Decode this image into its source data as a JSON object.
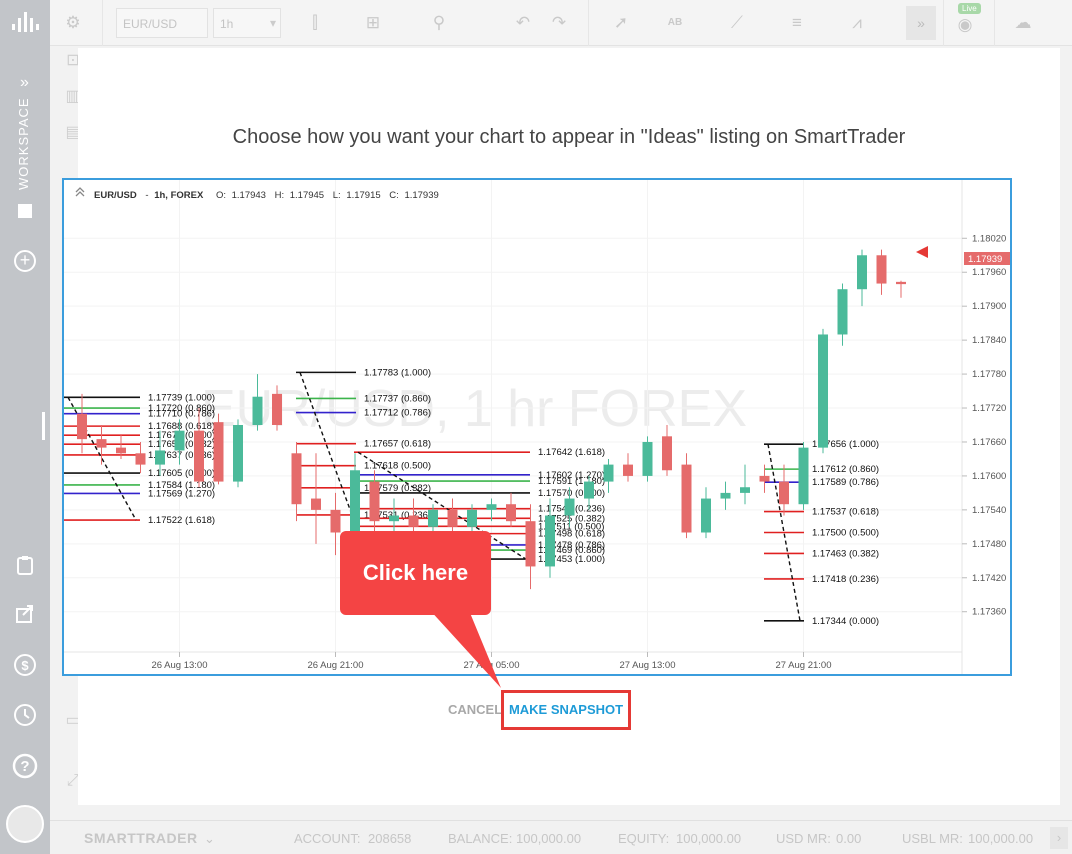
{
  "sidebar": {
    "workspace_label": "WORKSPACE"
  },
  "toolbar": {
    "symbol": "EUR/USD",
    "timeframe": "1h",
    "live_badge": "Live"
  },
  "modal": {
    "title": "Choose how you want your chart to appear in \"Ideas\" listing on SmartTrader",
    "cancel_label": "CANCEL",
    "snapshot_label": "MAKE SNAPSHOT",
    "callout_label": "Click here"
  },
  "chart": {
    "header": {
      "symbol": "EUR/USD",
      "interval": "1h, FOREX",
      "open_label": "O:",
      "open": "1.17943",
      "high_label": "H:",
      "high": "1.17945",
      "low_label": "L:",
      "low": "1.17915",
      "close_label": "C:",
      "close": "1.17939"
    },
    "watermark": "EUR/USD, 1 hr FOREX",
    "current_price": "1.17939",
    "colors": {
      "up": "#4bba9a",
      "down": "#e56b6b",
      "fib_black": "#111111",
      "fib_green": "#3cb44b",
      "fib_blue": "#3322cc",
      "fib_red": "#e02020",
      "accent": "#3b9ddd"
    }
  },
  "chart_data": {
    "type": "candlestick",
    "y_ticks": [
      "1.18020",
      "1.17960",
      "1.17900",
      "1.17840",
      "1.17780",
      "1.17720",
      "1.17660",
      "1.17600",
      "1.17540",
      "1.17480",
      "1.17420",
      "1.17360"
    ],
    "ylim": [
      1.1731,
      1.1807
    ],
    "x_ticks": [
      "26 Aug 13:00",
      "26 Aug 21:00",
      "27 Aug 05:00",
      "27 Aug 13:00",
      "27 Aug 21:00"
    ],
    "candles": [
      {
        "i": 0,
        "o": 1.1771,
        "h": 1.17745,
        "l": 1.1764,
        "c": 1.17665
      },
      {
        "i": 1,
        "o": 1.17665,
        "h": 1.1769,
        "l": 1.1762,
        "c": 1.1765
      },
      {
        "i": 2,
        "o": 1.1765,
        "h": 1.17672,
        "l": 1.1763,
        "c": 1.1764
      },
      {
        "i": 3,
        "o": 1.1764,
        "h": 1.1766,
        "l": 1.17605,
        "c": 1.1762
      },
      {
        "i": 4,
        "o": 1.1762,
        "h": 1.1768,
        "l": 1.176,
        "c": 1.17645
      },
      {
        "i": 5,
        "o": 1.17645,
        "h": 1.177,
        "l": 1.1762,
        "c": 1.1768
      },
      {
        "i": 6,
        "o": 1.1768,
        "h": 1.1772,
        "l": 1.1758,
        "c": 1.1759
      },
      {
        "i": 7,
        "o": 1.17695,
        "h": 1.1771,
        "l": 1.17585,
        "c": 1.1759
      },
      {
        "i": 8,
        "o": 1.1759,
        "h": 1.177,
        "l": 1.1758,
        "c": 1.1769
      },
      {
        "i": 9,
        "o": 1.1769,
        "h": 1.1778,
        "l": 1.1768,
        "c": 1.1774
      },
      {
        "i": 10,
        "o": 1.17745,
        "h": 1.1776,
        "l": 1.1768,
        "c": 1.1769
      },
      {
        "i": 11,
        "o": 1.1764,
        "h": 1.1766,
        "l": 1.1752,
        "c": 1.1755
      },
      {
        "i": 12,
        "o": 1.1756,
        "h": 1.1764,
        "l": 1.1748,
        "c": 1.1754
      },
      {
        "i": 13,
        "o": 1.1754,
        "h": 1.1757,
        "l": 1.1746,
        "c": 1.175
      },
      {
        "i": 14,
        "o": 1.175,
        "h": 1.1764,
        "l": 1.1749,
        "c": 1.1761
      },
      {
        "i": 15,
        "o": 1.1759,
        "h": 1.1761,
        "l": 1.1748,
        "c": 1.1752
      },
      {
        "i": 16,
        "o": 1.1752,
        "h": 1.1756,
        "l": 1.175,
        "c": 1.1753
      },
      {
        "i": 17,
        "o": 1.1753,
        "h": 1.1756,
        "l": 1.175,
        "c": 1.1751
      },
      {
        "i": 18,
        "o": 1.1751,
        "h": 1.1755,
        "l": 1.1749,
        "c": 1.1754
      },
      {
        "i": 19,
        "o": 1.1754,
        "h": 1.1756,
        "l": 1.175,
        "c": 1.1751
      },
      {
        "i": 20,
        "o": 1.1751,
        "h": 1.1755,
        "l": 1.17495,
        "c": 1.1754
      },
      {
        "i": 21,
        "o": 1.1754,
        "h": 1.1756,
        "l": 1.1752,
        "c": 1.1755
      },
      {
        "i": 22,
        "o": 1.1755,
        "h": 1.1757,
        "l": 1.1751,
        "c": 1.1752
      },
      {
        "i": 23,
        "o": 1.1752,
        "h": 1.1755,
        "l": 1.174,
        "c": 1.1744
      },
      {
        "i": 24,
        "o": 1.1744,
        "h": 1.1756,
        "l": 1.1742,
        "c": 1.1753
      },
      {
        "i": 25,
        "o": 1.1753,
        "h": 1.1758,
        "l": 1.1751,
        "c": 1.1756
      },
      {
        "i": 26,
        "o": 1.1756,
        "h": 1.176,
        "l": 1.1754,
        "c": 1.1759
      },
      {
        "i": 27,
        "o": 1.1759,
        "h": 1.1763,
        "l": 1.1757,
        "c": 1.1762
      },
      {
        "i": 28,
        "o": 1.1762,
        "h": 1.1764,
        "l": 1.1759,
        "c": 1.176
      },
      {
        "i": 29,
        "o": 1.176,
        "h": 1.1767,
        "l": 1.1759,
        "c": 1.1766
      },
      {
        "i": 30,
        "o": 1.1767,
        "h": 1.1769,
        "l": 1.176,
        "c": 1.1761
      },
      {
        "i": 31,
        "o": 1.1762,
        "h": 1.1764,
        "l": 1.1749,
        "c": 1.175
      },
      {
        "i": 32,
        "o": 1.175,
        "h": 1.1758,
        "l": 1.1749,
        "c": 1.1756
      },
      {
        "i": 33,
        "o": 1.1756,
        "h": 1.1759,
        "l": 1.1754,
        "c": 1.1757
      },
      {
        "i": 34,
        "o": 1.1757,
        "h": 1.1762,
        "l": 1.1755,
        "c": 1.1758
      },
      {
        "i": 35,
        "o": 1.176,
        "h": 1.1762,
        "l": 1.1757,
        "c": 1.1759
      },
      {
        "i": 36,
        "o": 1.1759,
        "h": 1.1762,
        "l": 1.1753,
        "c": 1.1755
      },
      {
        "i": 37,
        "o": 1.1755,
        "h": 1.1766,
        "l": 1.1754,
        "c": 1.1765
      },
      {
        "i": 38,
        "o": 1.1765,
        "h": 1.1786,
        "l": 1.1764,
        "c": 1.1785
      },
      {
        "i": 39,
        "o": 1.1785,
        "h": 1.1794,
        "l": 1.1783,
        "c": 1.1793
      },
      {
        "i": 40,
        "o": 1.1793,
        "h": 1.18,
        "l": 1.179,
        "c": 1.1799
      },
      {
        "i": 41,
        "o": 1.1799,
        "h": 1.18,
        "l": 1.1792,
        "c": 1.1794
      },
      {
        "i": 42,
        "o": 1.17943,
        "h": 1.17945,
        "l": 1.17915,
        "c": 1.17939
      }
    ],
    "fib_levels": [
      {
        "group": 1,
        "labels": [
          "1.17739 (1.000)",
          "1.17720 (0.860)",
          "1.17710 (0.786)",
          "1.17688 (0.618)",
          "1.17672 (0.500)",
          "1.17656 (0.382)",
          "1.17637 (0.236)",
          "1.17605 (0.000)",
          "1.17584 (1.180)",
          "1.17569 (1.270)",
          "1.17522 (1.618)"
        ]
      },
      {
        "group": 2,
        "labels": [
          "1.17783 (1.000)",
          "1.17737 (0.860)",
          "1.17712 (0.786)",
          "1.17657 (0.618)",
          "1.17618 (0.500)",
          "1.17579 (0.382)",
          "1.17531 (0.236)"
        ]
      },
      {
        "group": 3,
        "labels": [
          "1.17642 (1.618)",
          "1.17602 (1.270)",
          "1.17591 (1.180)",
          "1.17570 (0.000)",
          "1.17542 (0.236)",
          "1.17525 (0.382)",
          "1.17511 (0.500)",
          "1.17498 (0.618)",
          "1.17478 (0.786)",
          "1.17469 (0.860)",
          "1.17453 (1.000)"
        ]
      },
      {
        "group": 4,
        "labels": [
          "1.17656 (1.000)",
          "1.17612 (0.860)",
          "1.17589 (0.786)",
          "1.17537 (0.618)",
          "1.17500 (0.500)",
          "1.17463 (0.382)",
          "1.17418 (0.236)",
          "1.17344 (0.000)"
        ]
      }
    ]
  },
  "statusbar": {
    "brand": "SMARTTRADER",
    "account_label": "ACCOUNT:",
    "account": "208658",
    "balance_label": "BALANCE:",
    "balance": "100,000.00",
    "equity_label": "EQUITY:",
    "equity": "100,000.00",
    "usd_mr_label": "USD MR:",
    "usd_mr": "0.00",
    "usbl_mr_label": "USBL MR:",
    "usbl_mr": "100,000.00"
  }
}
